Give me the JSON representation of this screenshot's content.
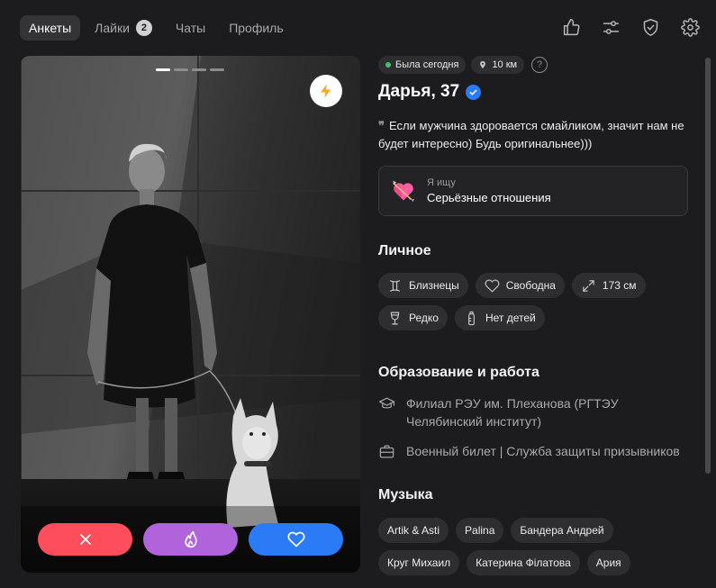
{
  "nav": {
    "tabs": [
      {
        "label": "Анкеты",
        "active": true
      },
      {
        "label": "Лайки",
        "badge": "2"
      },
      {
        "label": "Чаты"
      },
      {
        "label": "Профиль"
      }
    ],
    "icons": [
      "thumbs-up-icon",
      "sliders-icon",
      "shield-check-icon",
      "gear-icon"
    ]
  },
  "photo": {
    "pages_total": 4,
    "page_current": 1,
    "boost_icon": "lightning-icon",
    "actions": {
      "dislike_icon": "close-icon",
      "superlike_icon": "flame-icon",
      "like_icon": "heart-icon"
    }
  },
  "profile": {
    "status": "Была сегодня",
    "distance": "10 км",
    "help": "?",
    "name": "Дарья, 37",
    "verified": true,
    "bio_quote": "❞",
    "bio": "Если мужчина здоровается смайликом, значит нам не будет интересно) Будь оригинальнее)))",
    "looking_for": {
      "label": "Я ищу",
      "value": "Серьёзные отношения",
      "icon": "heart-with-arrow-icon"
    }
  },
  "personal": {
    "title": "Личное",
    "chips": [
      {
        "label": "Близнецы",
        "icon": "gemini-icon"
      },
      {
        "label": "Свободна",
        "icon": "heart-outline-icon"
      },
      {
        "label": "173 см",
        "icon": "expand-arrows-icon"
      },
      {
        "label": "Редко",
        "icon": "wine-glass-icon"
      },
      {
        "label": "Нет детей",
        "icon": "baby-bottle-icon"
      }
    ]
  },
  "education": {
    "title": "Образование и работа",
    "items": [
      {
        "text": "Филиал РЭУ им. Плеханова (РГТЭУ Челябинский институт)",
        "icon": "graduation-cap-icon"
      },
      {
        "text": "Военный билет | Служба защиты призывников",
        "icon": "briefcase-icon"
      }
    ]
  },
  "music": {
    "title": "Музыка",
    "chips": [
      "Artik & Asti",
      "Palina",
      "Бандера Андрей",
      "Круг Михаил",
      "Катерина Філатова",
      "Ария"
    ]
  },
  "colors": {
    "background": "#1c1c1e",
    "dislike": "#fe4e5c",
    "superlike": "#b163dc",
    "like": "#2a7bf5",
    "online": "#3ec46d",
    "verified": "#2a7bf5"
  }
}
